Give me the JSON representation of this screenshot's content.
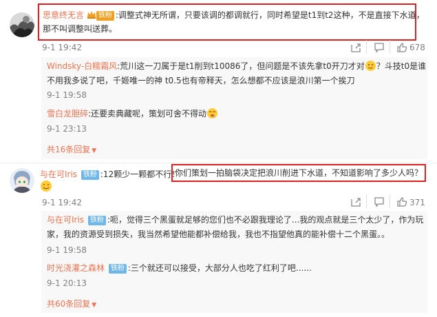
{
  "comment1": {
    "username": "思意终无言",
    "badge": "铁粉",
    "text_line1": ":调整式神无所谓，只要该调的都调就行，同时希望是t1到t2这种，不是直接下水道，",
    "text_line2": "那不叫调整叫送葬。",
    "time": "9-1 19:42",
    "likes": "678"
  },
  "replies1": [
    {
      "username": "Windsky-白糯霜风",
      "text_line1": ":荒川这一刀属于是t1削到t10086了，但问题是不该先拿t0开刀才对",
      "text_line1b": "？斗技t0是谁",
      "text_line2": "不用我多说了吧，千姬唯一的神 t0.5也有帝释天，怎么想都不应该是浪川第一个挨刀",
      "time": "9-1 19:58"
    },
    {
      "username": "雪白龙胆碎",
      "text": ":还要卖典藏呢，策划可舍不得动",
      "time": "9-1 23:13"
    }
  ],
  "expand1": "共16条回复",
  "comment2": {
    "username": "与在可Iris",
    "badge": "铁粉",
    "text_a": ":12颗少一颗都不行！",
    "text_b": "你们策划一拍脑袋决定把浪川削进下水道，不知道影响了多少人吗？",
    "time": "9-1 19:42",
    "likes": "371"
  },
  "replies2": [
    {
      "username": "与在可Iris",
      "badge": "铁粉",
      "text_line1": ":呃，觉得三个黑蛋就足够的您们也不必跟我理论了...我的观点就是三个太少了，作为玩",
      "text_line2": "家，我的资源受到损失，我当然希望他能都补偿给我，我也不指望他真的能补偿十二个黑蛋。。",
      "time": "9-1 19:58"
    },
    {
      "username": "时光浇灌之森林",
      "badge": "铁粉",
      "text": ":三个就还可以接受，大部分人也吃了红利了吧......",
      "time": "9-1 20:13"
    }
  ],
  "expand2": "共60条回复"
}
